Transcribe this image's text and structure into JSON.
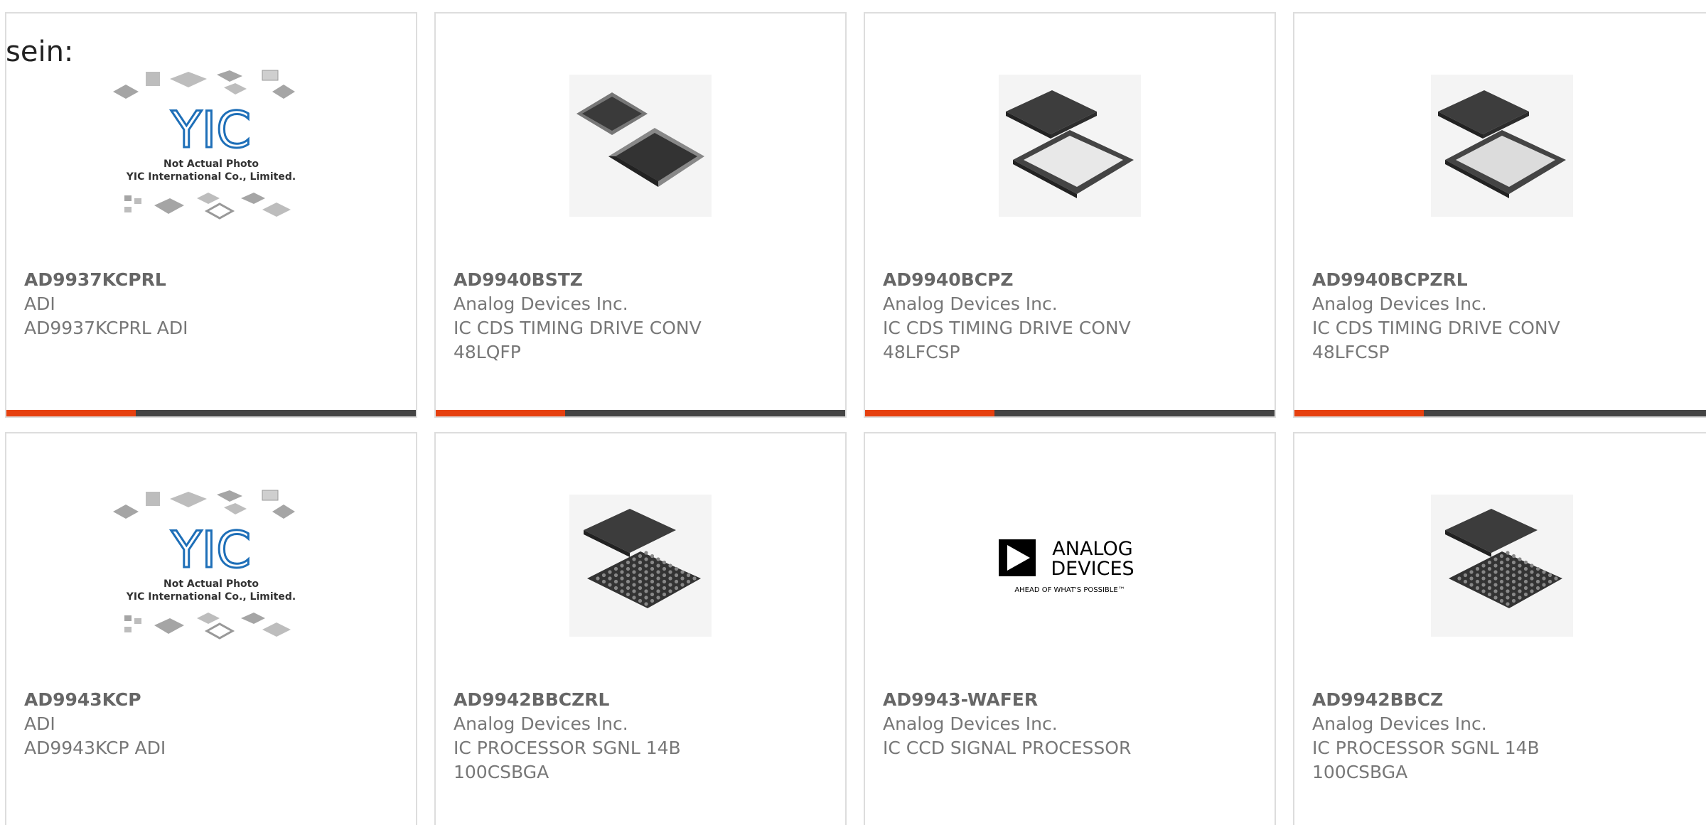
{
  "header_text": "sein:",
  "placeholder": {
    "logo_text": "YIC",
    "line1": "Not Actual Photo",
    "line2": "YIC International Co., Limited."
  },
  "analog_logo": {
    "line1": "ANALOG",
    "line2": "DEVICES",
    "tagline": "AHEAD OF WHAT'S POSSIBLE™"
  },
  "colors": {
    "accent": "#e6400f",
    "bar": "#444444",
    "border": "#dddddd",
    "text": "#777777"
  },
  "products": [
    {
      "part": "AD9937KCPRL",
      "maker": "ADI",
      "desc1": "AD9937KCPRL ADI",
      "desc2": "",
      "image": "yic-placeholder"
    },
    {
      "part": "AD9940BSTZ",
      "maker": "Analog Devices Inc.",
      "desc1": "IC CDS TIMING DRIVE CONV",
      "desc2": "48LQFP",
      "image": "lqfp-chip"
    },
    {
      "part": "AD9940BCPZ",
      "maker": "Analog Devices Inc.",
      "desc1": "IC CDS TIMING DRIVE CONV",
      "desc2": "48LFCSP",
      "image": "lfcsp-chip"
    },
    {
      "part": "AD9940BCPZRL",
      "maker": "Analog Devices Inc.",
      "desc1": "IC CDS TIMING DRIVE CONV",
      "desc2": "48LFCSP",
      "image": "lfcsp-chip"
    },
    {
      "part": "AD9943KCP",
      "maker": "ADI",
      "desc1": "AD9943KCP ADI",
      "desc2": "",
      "image": "yic-placeholder"
    },
    {
      "part": "AD9942BBCZRL",
      "maker": "Analog Devices Inc.",
      "desc1": "IC PROCESSOR SGNL 14B",
      "desc2": "100CSBGA",
      "image": "bga-chip"
    },
    {
      "part": "AD9943-WAFER",
      "maker": "Analog Devices Inc.",
      "desc1": "IC CCD SIGNAL PROCESSOR",
      "desc2": "",
      "image": "analog-devices-logo"
    },
    {
      "part": "AD9942BBCZ",
      "maker": "Analog Devices Inc.",
      "desc1": "IC PROCESSOR SGNL 14B",
      "desc2": "100CSBGA",
      "image": "bga-chip"
    }
  ]
}
